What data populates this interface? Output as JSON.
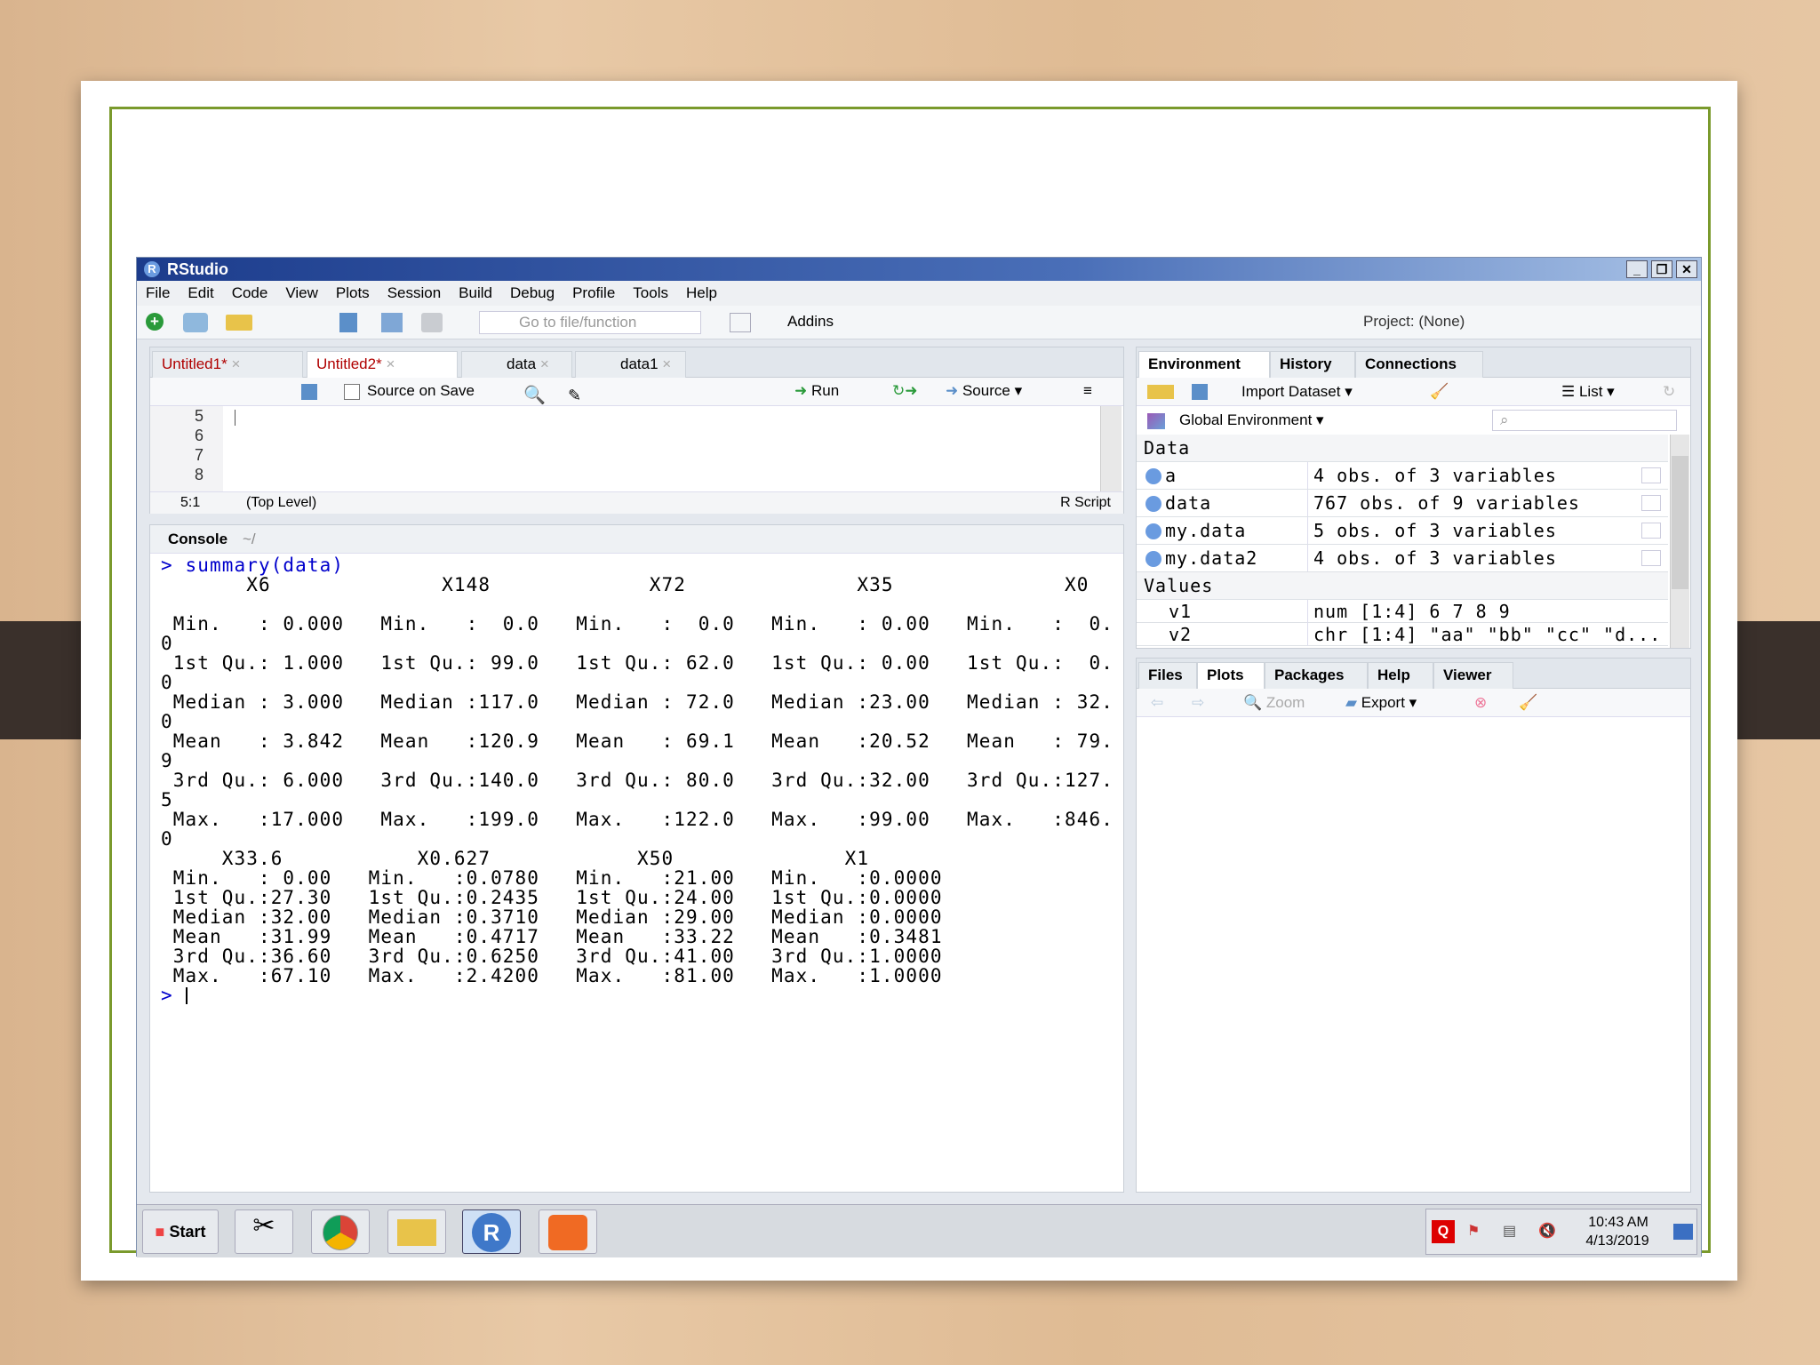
{
  "window": {
    "title": "RStudio",
    "min": "_",
    "max": "❐",
    "close": "✕"
  },
  "menu": [
    "File",
    "Edit",
    "Code",
    "View",
    "Plots",
    "Session",
    "Build",
    "Debug",
    "Profile",
    "Tools",
    "Help"
  ],
  "toolbar": {
    "goto_placeholder": "Go to file/function",
    "addins": "Addins",
    "project": "Project: (None)"
  },
  "editor": {
    "tabs": [
      "Untitled1*",
      "Untitled2*",
      "data",
      "data1"
    ],
    "source_on_save": "Source on Save",
    "run": "Run",
    "source": "Source",
    "line_numbers": [
      "5",
      "6",
      "7",
      "8"
    ],
    "cursor_pos": "5:1",
    "scope": "(Top Level)",
    "file_type": "R Script"
  },
  "console": {
    "title": "Console",
    "path": "~/",
    "lines": [
      "> summary(data)",
      "       X6              X148             X72              X35              X0",
      "",
      " Min.   : 0.000   Min.   :  0.0   Min.   :  0.0   Min.   : 0.00   Min.   :  0.",
      "0",
      " 1st Qu.: 1.000   1st Qu.: 99.0   1st Qu.: 62.0   1st Qu.: 0.00   1st Qu.:  0.",
      "0",
      " Median : 3.000   Median :117.0   Median : 72.0   Median :23.00   Median : 32.",
      "0",
      " Mean   : 3.842   Mean   :120.9   Mean   : 69.1   Mean   :20.52   Mean   : 79.",
      "9",
      " 3rd Qu.: 6.000   3rd Qu.:140.0   3rd Qu.: 80.0   3rd Qu.:32.00   3rd Qu.:127.",
      "5",
      " Max.   :17.000   Max.   :199.0   Max.   :122.0   Max.   :99.00   Max.   :846.",
      "0",
      "     X33.6           X0.627            X50              X1",
      " Min.   : 0.00   Min.   :0.0780   Min.   :21.00   Min.   :0.0000",
      " 1st Qu.:27.30   1st Qu.:0.2435   1st Qu.:24.00   1st Qu.:0.0000",
      " Median :32.00   Median :0.3710   Median :29.00   Median :0.0000",
      " Mean   :31.99   Mean   :0.4717   Mean   :33.22   Mean   :0.3481",
      " 3rd Qu.:36.60   3rd Qu.:0.6250   3rd Qu.:41.00   3rd Qu.:1.0000",
      " Max.   :67.10   Max.   :2.4200   Max.   :81.00   Max.   :1.0000",
      "> "
    ]
  },
  "environment": {
    "tabs": [
      "Environment",
      "History",
      "Connections"
    ],
    "import_dataset": "Import Dataset",
    "view_mode": "List",
    "scope": "Global Environment",
    "data_header": "Data",
    "data": [
      {
        "name": "a",
        "value": "4 obs. of 3 variables"
      },
      {
        "name": "data",
        "value": "767 obs. of 9 variables"
      },
      {
        "name": "my.data",
        "value": "5 obs. of 3 variables"
      },
      {
        "name": "my.data2",
        "value": "4 obs. of 3 variables"
      }
    ],
    "values_header": "Values",
    "values": [
      {
        "name": "v1",
        "value": "num [1:4] 6 7 8 9"
      },
      {
        "name": "v2",
        "value": "chr [1:4] \"aa\" \"bb\" \"cc\" \"d..."
      }
    ]
  },
  "files": {
    "tabs": [
      "Files",
      "Plots",
      "Packages",
      "Help",
      "Viewer"
    ],
    "zoom": "Zoom",
    "export": "Export"
  },
  "taskbar": {
    "start": "Start",
    "time": "10:43 AM",
    "date": "4/13/2019"
  },
  "colors": {
    "accent": "#1c3c8c",
    "console_cmd": "#0000cc",
    "tab_modified": "#b00000"
  }
}
